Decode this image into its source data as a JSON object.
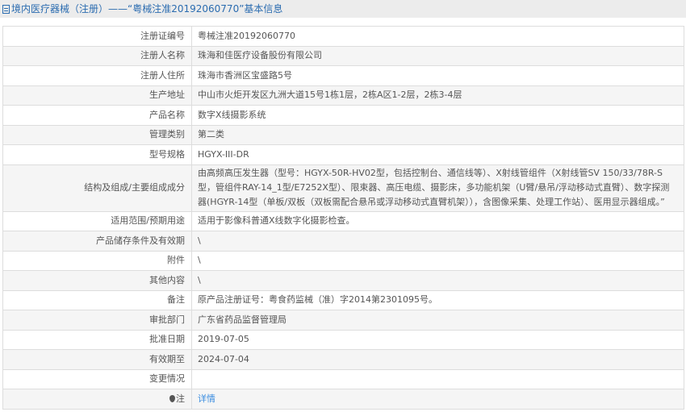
{
  "header": {
    "title": "境内医疗器械（注册）——“粤械注准20192060770”基本信息",
    "icon": "document-icon"
  },
  "rows": [
    {
      "label": "注册证编号",
      "value": "粤械注准20192060770"
    },
    {
      "label": "注册人名称",
      "value": "珠海和佳医疗设备股份有限公司"
    },
    {
      "label": "注册人住所",
      "value": "珠海市香洲区宝盛路5号"
    },
    {
      "label": "生产地址",
      "value": "中山市火炬开发区九洲大道15号1栋1层，2栋A区1-2层，2栋3-4层"
    },
    {
      "label": "产品名称",
      "value": "数字X线摄影系统"
    },
    {
      "label": "管理类别",
      "value": "第二类"
    },
    {
      "label": "型号规格",
      "value": "HGYX-III-DR"
    },
    {
      "label": "结构及组成/主要组成成分",
      "value": "由高频高压发生器（型号：HGYX-50R-HV02型，包括控制台、通信线等）、X射线管组件（X射线管SV 150/33/78R-S型，管组件RAY-14_1型/E7252X型）、限束器、高压电缆、摄影床，多功能机架（U臂/悬吊/浮动移动式直臂）、数字探测器(HGYR-14型（单板/双板（双板需配合悬吊或浮动移动式直臂机架）），含图像采集、处理工作站）、医用显示器组成。”"
    },
    {
      "label": "适用范围/预期用途",
      "value": "适用于影像科普通X线数字化摄影检查。"
    },
    {
      "label": "产品储存条件及有效期",
      "value": "\\"
    },
    {
      "label": "附件",
      "value": "\\"
    },
    {
      "label": "其他内容",
      "value": "\\"
    },
    {
      "label": "备注",
      "value": "原产品注册证号：粤食药监械（准）字2014第2301095号。"
    },
    {
      "label": "审批部门",
      "value": "广东省药品监督管理局"
    },
    {
      "label": "批准日期",
      "value": "2019-07-05"
    },
    {
      "label": "有效期至",
      "value": "2024-07-04"
    },
    {
      "label": "变更情况",
      "value": ""
    },
    {
      "label": "注",
      "value": "详情"
    }
  ]
}
